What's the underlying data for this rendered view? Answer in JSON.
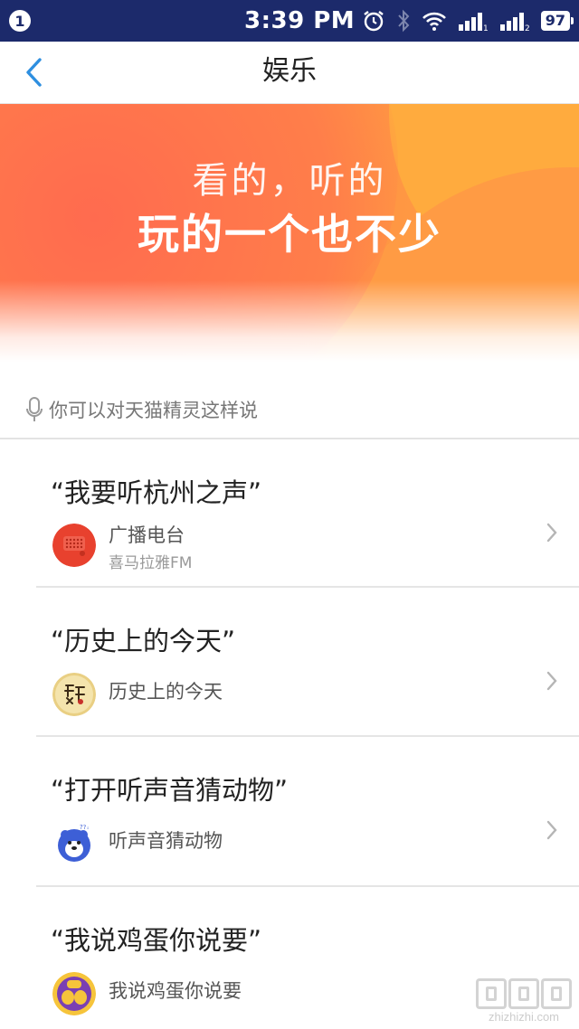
{
  "status_bar": {
    "notification_count": "1",
    "time": "3:39 PM",
    "battery": "97",
    "icons": [
      "alarm-icon",
      "bluetooth-icon",
      "wifi-icon",
      "signal-icon-sim1",
      "signal-icon-sim2",
      "battery-icon"
    ]
  },
  "nav": {
    "title": "娱乐",
    "back_icon": "chevron-left-icon"
  },
  "banner": {
    "line1": "看的，听的",
    "line2": "玩的一个也不少"
  },
  "hint": {
    "icon": "microphone-icon",
    "text": "你可以对天猫精灵这样说"
  },
  "commands": [
    {
      "quote": "“我要听杭州之声”",
      "skill_name": "广播电台",
      "skill_sub": "喜马拉雅FM",
      "icon": "radio-icon",
      "has_chevron": true
    },
    {
      "quote": "“历史上的今天”",
      "skill_name": "历史上的今天",
      "skill_sub": "",
      "icon": "history-today-icon",
      "has_chevron": true
    },
    {
      "quote": "“打开听声音猜动物”",
      "skill_name": "听声音猜动物",
      "skill_sub": "",
      "icon": "animal-guess-icon",
      "has_chevron": true
    },
    {
      "quote": "“我说鸡蛋你说要”",
      "skill_name": "我说鸡蛋你说要",
      "skill_sub": "",
      "icon": "egg-game-icon",
      "has_chevron": false
    }
  ],
  "watermark": {
    "text": "zhizhizhi.com"
  },
  "colors": {
    "status_bar_bg": "#1c2a6b",
    "accent_blue": "#2e8fe0",
    "banner_orange": "#ff8a45"
  }
}
